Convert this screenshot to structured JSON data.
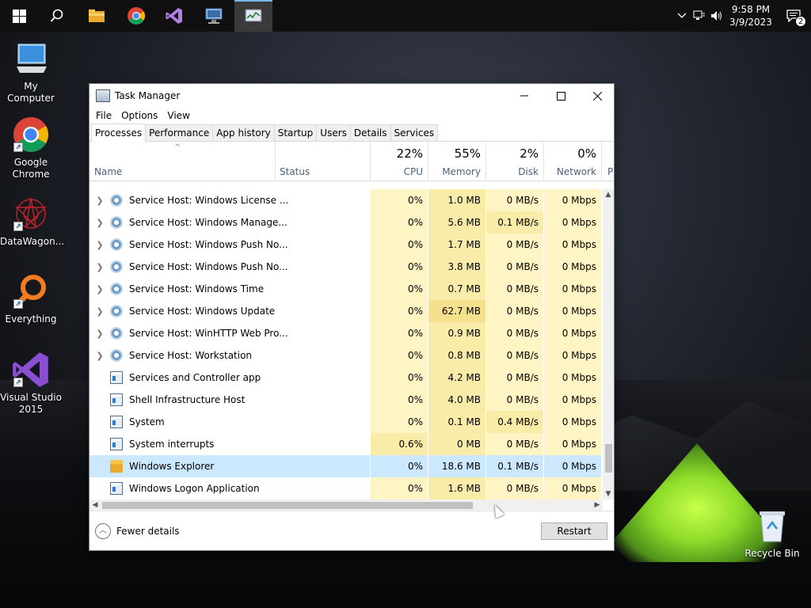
{
  "taskbar": {
    "clock_time": "9:58 PM",
    "clock_date": "3/9/2023",
    "notification_count": "2"
  },
  "desktop_icons": [
    {
      "label": "My Computer"
    },
    {
      "label": "Google Chrome"
    },
    {
      "label": "DataWagon..."
    },
    {
      "label": "Everything"
    },
    {
      "label": "Visual Studio 2015"
    },
    {
      "label": "Recycle Bin"
    }
  ],
  "window": {
    "title": "Task Manager",
    "menu": [
      "File",
      "Options",
      "View"
    ],
    "tabs": [
      "Processes",
      "Performance",
      "App history",
      "Startup",
      "Users",
      "Details",
      "Services"
    ],
    "active_tab": "Processes"
  },
  "columns": {
    "name": "Name",
    "status": "Status",
    "cpu": {
      "pct": "22%",
      "label": "CPU"
    },
    "memory": {
      "pct": "55%",
      "label": "Memory"
    },
    "disk": {
      "pct": "2%",
      "label": "Disk"
    },
    "network": {
      "pct": "0%",
      "label": "Network"
    },
    "power_partial": "P"
  },
  "processes": [
    {
      "name": "Service Host: Windows License ...",
      "icon": "gear-icon",
      "expandable": true,
      "cpu": "0%",
      "memory": "1.0 MB",
      "disk": "0 MB/s",
      "network": "0 Mbps"
    },
    {
      "name": "Service Host: Windows Manage...",
      "icon": "gear-icon",
      "expandable": true,
      "cpu": "0%",
      "memory": "5.6 MB",
      "disk": "0.1 MB/s",
      "network": "0 Mbps"
    },
    {
      "name": "Service Host: Windows Push No...",
      "icon": "gear-icon",
      "expandable": true,
      "cpu": "0%",
      "memory": "1.7 MB",
      "disk": "0 MB/s",
      "network": "0 Mbps"
    },
    {
      "name": "Service Host: Windows Push No...",
      "icon": "gear-icon",
      "expandable": true,
      "cpu": "0%",
      "memory": "3.8 MB",
      "disk": "0 MB/s",
      "network": "0 Mbps"
    },
    {
      "name": "Service Host: Windows Time",
      "icon": "gear-icon",
      "expandable": true,
      "cpu": "0%",
      "memory": "0.7 MB",
      "disk": "0 MB/s",
      "network": "0 Mbps"
    },
    {
      "name": "Service Host: Windows Update",
      "icon": "gear-icon",
      "expandable": true,
      "cpu": "0%",
      "memory": "62.7 MB",
      "disk": "0 MB/s",
      "network": "0 Mbps"
    },
    {
      "name": "Service Host: WinHTTP Web Pro...",
      "icon": "gear-icon",
      "expandable": true,
      "cpu": "0%",
      "memory": "0.9 MB",
      "disk": "0 MB/s",
      "network": "0 Mbps"
    },
    {
      "name": "Service Host: Workstation",
      "icon": "gear-icon",
      "expandable": true,
      "cpu": "0%",
      "memory": "0.8 MB",
      "disk": "0 MB/s",
      "network": "0 Mbps"
    },
    {
      "name": "Services and Controller app",
      "icon": "app-window-icon",
      "expandable": false,
      "cpu": "0%",
      "memory": "4.2 MB",
      "disk": "0 MB/s",
      "network": "0 Mbps"
    },
    {
      "name": "Shell Infrastructure Host",
      "icon": "app-window-icon",
      "expandable": false,
      "cpu": "0%",
      "memory": "4.0 MB",
      "disk": "0 MB/s",
      "network": "0 Mbps"
    },
    {
      "name": "System",
      "icon": "app-window-icon",
      "expandable": false,
      "cpu": "0%",
      "memory": "0.1 MB",
      "disk": "0.4 MB/s",
      "network": "0 Mbps"
    },
    {
      "name": "System interrupts",
      "icon": "app-window-icon",
      "expandable": false,
      "cpu": "0.6%",
      "memory": "0 MB",
      "disk": "0 MB/s",
      "network": "0 Mbps"
    },
    {
      "name": "Windows Explorer",
      "icon": "folder-icon",
      "expandable": false,
      "selected": true,
      "cpu": "0%",
      "memory": "18.6 MB",
      "disk": "0.1 MB/s",
      "network": "0 Mbps"
    },
    {
      "name": "Windows Logon Application",
      "icon": "app-window-icon",
      "expandable": false,
      "cpu": "0%",
      "memory": "1.6 MB",
      "disk": "0 MB/s",
      "network": "0 Mbps"
    }
  ],
  "footer": {
    "fewer_details": "Fewer details",
    "restart": "Restart"
  },
  "colors": {
    "heat_light": "#fff4c4",
    "heat_medium": "#f9eca8",
    "heat_strong": "#f5e08e",
    "selected_row": "#cce8ff"
  }
}
